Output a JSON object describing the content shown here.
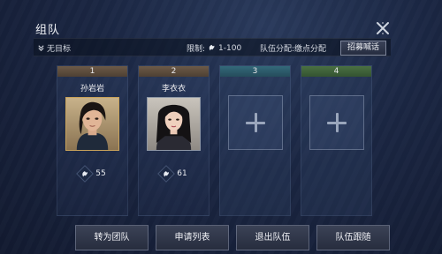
{
  "window": {
    "title": "组队"
  },
  "info_bar": {
    "target": "无目标",
    "level_label": "限制:",
    "level_range": "1-100",
    "distribution": "队伍分配:缴点分配",
    "recruit_label": "招募喊话"
  },
  "slots": [
    {
      "index": "1",
      "name": "孙岩岩",
      "level": "55"
    },
    {
      "index": "2",
      "name": "李衣衣",
      "level": "61"
    },
    {
      "index": "3"
    },
    {
      "index": "4"
    }
  ],
  "actions": {
    "convert_team": "转为团队",
    "apply_list": "申请列表",
    "leave_team": "退出队伍",
    "follow_team": "队伍跟随"
  },
  "colors": {
    "tab_1": "#5c4c3d",
    "tab_2": "#5c4c3d",
    "tab_3": "#2d5a6a",
    "tab_4": "#3f6139",
    "portrait_1_frame": "#c9a35a",
    "portrait_2_frame": "#8e97a6"
  },
  "icons": [
    "close-icon",
    "chevron-down-icon",
    "level-icon",
    "plus-icon"
  ]
}
